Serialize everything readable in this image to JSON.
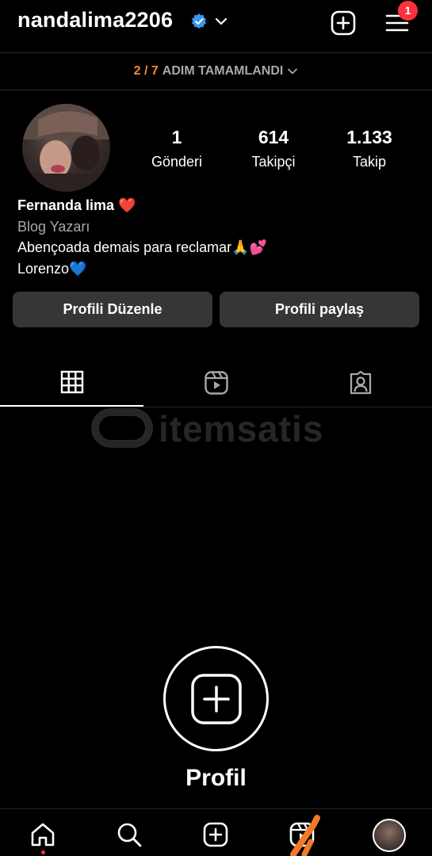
{
  "header": {
    "username": "nandalima2206",
    "notification_count": "1"
  },
  "steps": {
    "done": "2 / 7",
    "label": "ADIM TAMAMLANDI"
  },
  "stats": [
    {
      "value": "1",
      "label": "Gönderi"
    },
    {
      "value": "614",
      "label": "Takipçi"
    },
    {
      "value": "1.133",
      "label": "Takip"
    }
  ],
  "bio": {
    "name": "Fernanda lima ❤️",
    "category": "Blog Yazarı",
    "line1": "Abençoada demais para reclamar🙏💕",
    "line2": "Lorenzo💙"
  },
  "buttons": {
    "edit": "Profili Düzenle",
    "share": "Profili paylaş"
  },
  "watermark": {
    "text": "itemsatis"
  },
  "empty_state": {
    "title": "Profil"
  },
  "colors": {
    "accent_orange": "#f08a3a",
    "verified_blue": "#3897f0",
    "badge_red": "#ff3040",
    "button_bg": "#363636",
    "stroke_orange": "#f07a2a"
  },
  "icons": {
    "tabs": [
      "grid-icon",
      "reels-icon",
      "tagged-icon"
    ],
    "bottom_nav": [
      "home-icon",
      "search-icon",
      "create-icon",
      "reels-icon",
      "profile-avatar"
    ]
  }
}
